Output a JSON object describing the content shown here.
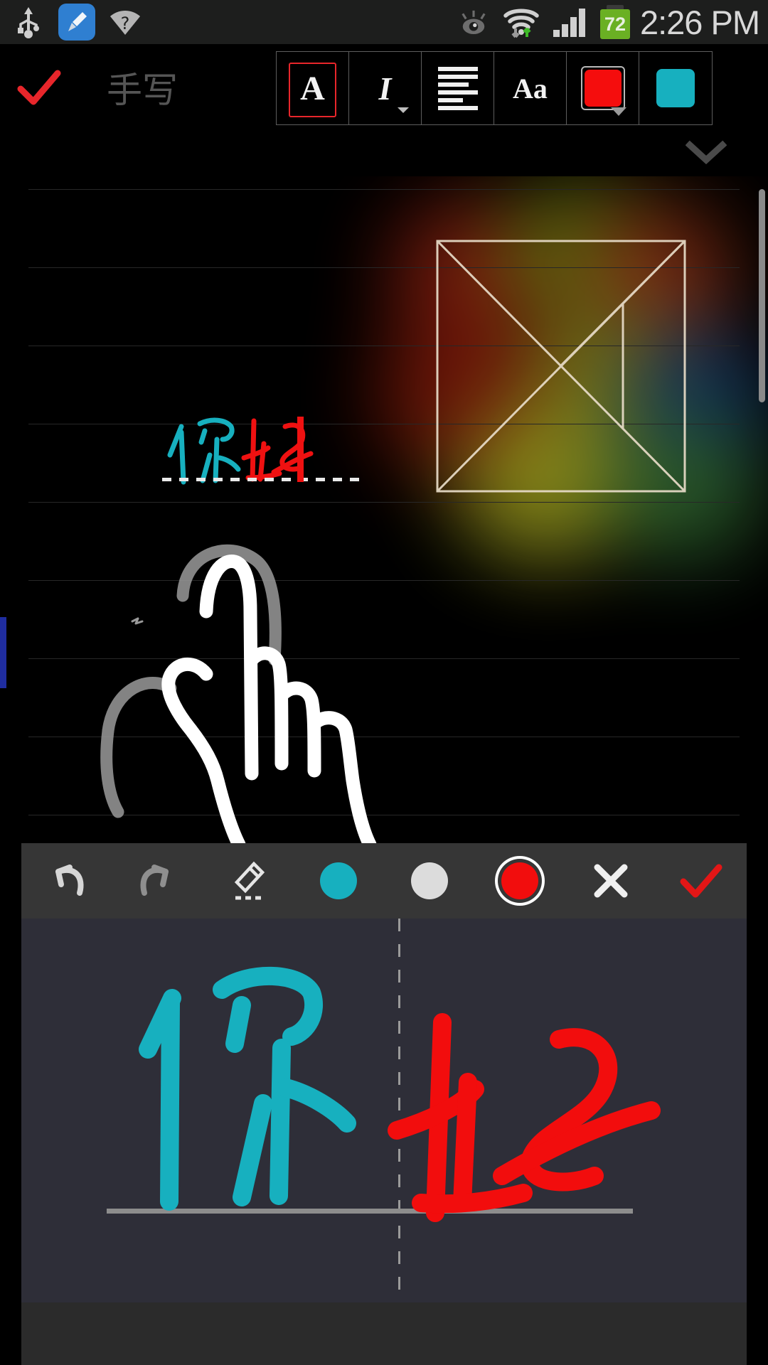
{
  "statusbar": {
    "time": "2:26 PM",
    "battery_percent": "72",
    "icons": [
      "usb-icon",
      "app-cleaner-icon",
      "wifi-question-icon",
      "smart-stay-eye-icon",
      "wifi-signal-icon",
      "cellular-signal-icon",
      "battery-icon"
    ]
  },
  "appbar": {
    "confirm_label": "✓",
    "title": "手写",
    "tools": [
      {
        "name": "text-style-button",
        "glyph": "A",
        "selected": true
      },
      {
        "name": "italic-button",
        "glyph": "I",
        "selected": false
      },
      {
        "name": "align-button",
        "glyph": "align",
        "selected": false
      },
      {
        "name": "font-size-button",
        "glyph": "Aa",
        "selected": false
      },
      {
        "name": "text-color-button",
        "glyph": "swatch",
        "color": "#f50d0d",
        "selected": false
      },
      {
        "name": "highlight-color-button",
        "glyph": "swatch",
        "color": "#17b0bf",
        "selected": false
      }
    ],
    "collapse_icon": "chevron-down-icon"
  },
  "note": {
    "handwritten_text": "你好",
    "ink_colors": {
      "first_char": "#17b0bf",
      "second_char": "#ef1111"
    },
    "caret_color": "#ef1111",
    "underline_style": "dashed",
    "page_marker_color": "#1f2da0",
    "attached_drawing": "tangram-square-sketch",
    "finger_sketch": "hand-pointing-drawing"
  },
  "toolstrip": {
    "background": "#363636",
    "buttons": [
      {
        "name": "undo-button",
        "icon": "undo-icon"
      },
      {
        "name": "redo-button",
        "icon": "redo-icon"
      },
      {
        "name": "eraser-button",
        "icon": "eraser-icon"
      },
      {
        "name": "color-cyan-button",
        "icon": "color-dot",
        "color": "#17b0bf",
        "selected": false
      },
      {
        "name": "color-white-button",
        "icon": "color-dot",
        "color": "#dcdcdc",
        "selected": false
      },
      {
        "name": "color-red-button",
        "icon": "color-dot",
        "color": "#f20d0d",
        "selected": true
      },
      {
        "name": "cancel-button",
        "icon": "close-icon"
      },
      {
        "name": "accept-button",
        "icon": "check-icon"
      }
    ]
  },
  "handwriting_pad": {
    "strokes_text": "你好",
    "left_cell_color": "#17b0bf",
    "right_cell_color": "#f20d0d",
    "background": "#2e2e38",
    "divider_style": "dashed",
    "baseline_color": "#8d8d8d"
  },
  "colors": {
    "status_bg": "#1d1e1d",
    "app_bg": "#000000",
    "accent_red": "#e8262b",
    "accent_cyan": "#17b0bf",
    "battery_green": "#6ab023"
  }
}
